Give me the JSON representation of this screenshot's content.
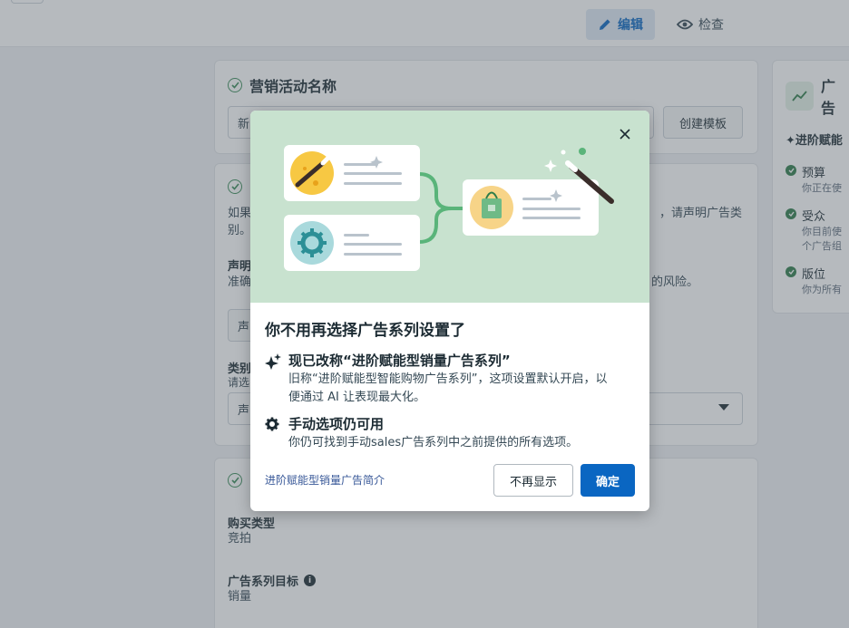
{
  "topbar": {
    "edit_label": "编辑",
    "inspect_label": "检查"
  },
  "campaign_name": {
    "title": "营销活动名称",
    "input_value": "新",
    "template_button": "创建模板"
  },
  "special_ad": {
    "title_partial": "",
    "desc_line1": "如果",
    "desc_line1_right": "，请声明广告类",
    "desc_line2": "别。",
    "declare_label": "声明",
    "declare_desc": "准确",
    "declare_desc_right": "的风险。",
    "declare_button": "声",
    "category_label": "类别",
    "category_hint": "请选",
    "category_select": "声"
  },
  "buying": {
    "buy_type_label": "购买类型",
    "buy_type_value": "竞拍",
    "objective_label": "广告系列目标",
    "objective_value": "销量"
  },
  "right_panel": {
    "title": "广告",
    "subtitle": "✦进阶赋能",
    "items": [
      {
        "label": "预算",
        "desc": "你正在使"
      },
      {
        "label": "受众",
        "desc": "你目前使",
        "desc2": "个广告组"
      },
      {
        "label": "版位",
        "desc": "你为所有"
      }
    ]
  },
  "modal": {
    "title": "你不用再选择广告系列设置了",
    "feature1_title": "现已改称“进阶赋能型销量广告系列”",
    "feature1_desc_line1": "旧称“进阶赋能型智能购物广告系列”，这项设置默认开启，以",
    "feature1_desc_line2": "便通过 AI 让表现最大化。",
    "feature2_title": "手动选项仍可用",
    "feature2_desc": "你仍可找到手动sales广告系列中之前提供的所有选项。",
    "learn_more_link": "进阶赋能型销量广告简介",
    "dismiss_button": "不再显示",
    "confirm_button": "确定"
  },
  "colors": {
    "primary": "#0a66c2",
    "hero_bg": "#c8e2cf",
    "success": "#2f7d4a"
  }
}
